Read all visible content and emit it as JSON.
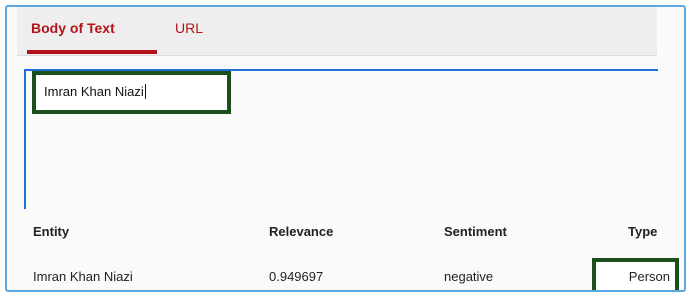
{
  "tabs": [
    {
      "label": "Body of Text",
      "active": true
    },
    {
      "label": "URL",
      "active": false
    }
  ],
  "input": {
    "value": "Imran Khan Niazi"
  },
  "table": {
    "headers": [
      "Entity",
      "Relevance",
      "Sentiment",
      "Type"
    ],
    "rows": [
      {
        "entity": "Imran Khan Niazi",
        "relevance": "0.949697",
        "sentiment": "negative",
        "type": "Person"
      }
    ]
  },
  "colors": {
    "accent": "#b3141b",
    "highlight_border": "#1d4f1d",
    "focus_border": "#1f6fd6",
    "frame_border": "#5aa8e2"
  }
}
